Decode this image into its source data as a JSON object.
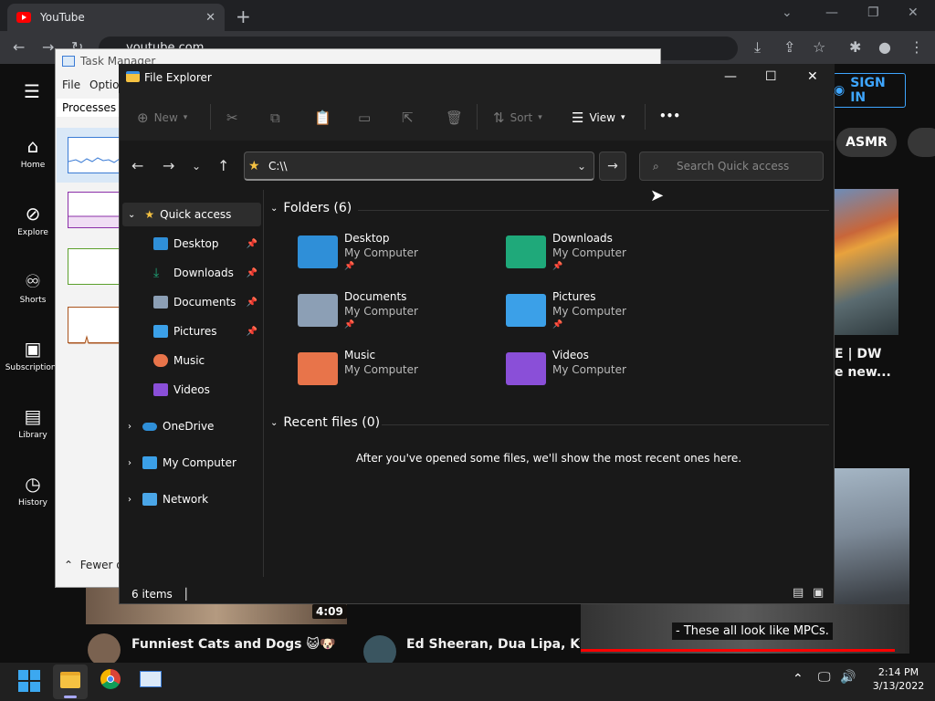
{
  "chrome": {
    "tab_title": "YouTube",
    "url": "youtube.com"
  },
  "youtube": {
    "nav": [
      {
        "label": "Home",
        "icon": "home-icon"
      },
      {
        "label": "Explore",
        "icon": "compass-icon"
      },
      {
        "label": "Shorts",
        "icon": "shorts-icon"
      },
      {
        "label": "Subscriptions",
        "icon": "subscriptions-icon"
      },
      {
        "label": "Library",
        "icon": "library-icon"
      },
      {
        "label": "History",
        "icon": "history-icon"
      }
    ],
    "sign_in": "SIGN IN",
    "chip_asmr": "ASMR",
    "video_fragment_1": "E | DW",
    "video_fragment_2": "e new...",
    "video1_title": "Funniest Cats and Dogs 😺🐶",
    "video1_duration": "4:09",
    "video2_title": "Ed Sheeran, Dua Lipa, Kygo, Av",
    "caption": "- These all look like MPCs."
  },
  "task_manager": {
    "title": "Task Manager",
    "menu_file": "File",
    "menu_options": "Optio",
    "tab_processes": "Processes",
    "fewer_details": "Fewer d"
  },
  "explorer": {
    "title": "File Explorer",
    "commands": {
      "new": "New",
      "sort": "Sort",
      "view": "View",
      "more": "•••"
    },
    "address": "C:\\\\",
    "search_placeholder": "Search Quick access",
    "sidebar": {
      "quick_access": "Quick access",
      "desktop": "Desktop",
      "downloads": "Downloads",
      "documents": "Documents",
      "pictures": "Pictures",
      "music": "Music",
      "videos": "Videos",
      "onedrive": "OneDrive",
      "my_computer": "My Computer",
      "network": "Network"
    },
    "folders_header": "Folders (6)",
    "folders": [
      {
        "name": "Desktop",
        "location": "My Computer",
        "color": "#2f8fd8"
      },
      {
        "name": "Downloads",
        "location": "My Computer",
        "color": "#1fa97a"
      },
      {
        "name": "Documents",
        "location": "My Computer",
        "color": "#8c9fb5"
      },
      {
        "name": "Pictures",
        "location": "My Computer",
        "color": "#3ba0e8"
      },
      {
        "name": "Music",
        "location": "My Computer",
        "color": "#e8744a"
      },
      {
        "name": "Videos",
        "location": "My Computer",
        "color": "#8a4fd8"
      }
    ],
    "recent_header": "Recent files (0)",
    "recent_empty": "After you've opened some files, we'll show the most recent ones here.",
    "status": "6 items"
  },
  "taskbar": {
    "time": "2:14 PM",
    "date": "3/13/2022"
  }
}
